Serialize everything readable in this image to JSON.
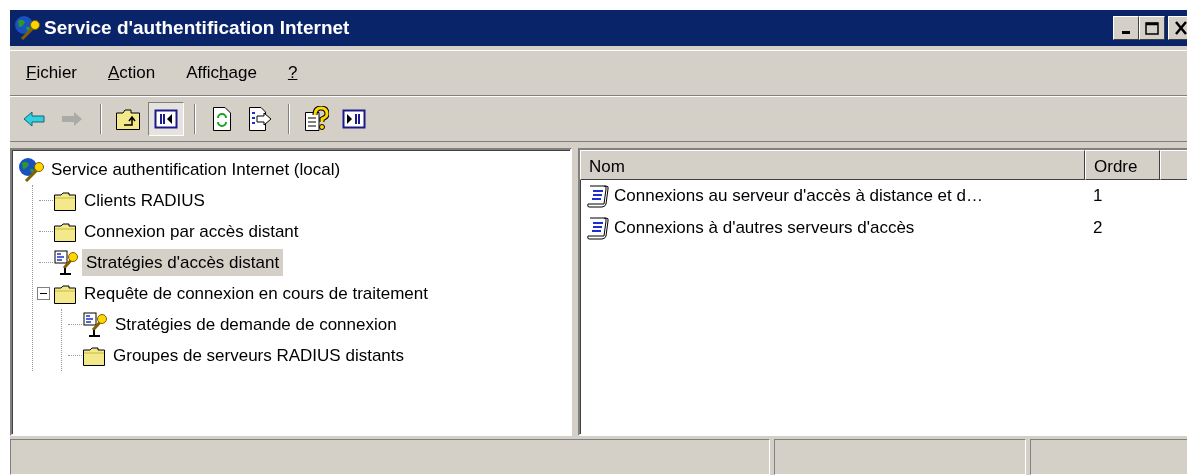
{
  "window": {
    "title": "Service d'authentification Internet"
  },
  "menu": [
    {
      "segments": [
        {
          "text": "F",
          "underlined": true
        },
        {
          "text": "ichier",
          "underlined": false
        }
      ]
    },
    {
      "segments": [
        {
          "text": "A",
          "underlined": true
        },
        {
          "text": "ction",
          "underlined": false
        }
      ]
    },
    {
      "segments": [
        {
          "text": "Affic",
          "underlined": false
        },
        {
          "text": "h",
          "underlined": true
        },
        {
          "text": "age",
          "underlined": false
        }
      ]
    },
    {
      "segments": [
        {
          "text": "?",
          "underlined": true
        }
      ]
    }
  ],
  "toolbar_groups": [
    {
      "buttons": [
        {
          "kind": "back",
          "disabled": false,
          "pressed": false
        },
        {
          "kind": "forward",
          "disabled": true,
          "pressed": false
        }
      ]
    },
    {
      "buttons": [
        {
          "kind": "up",
          "disabled": false,
          "pressed": false
        },
        {
          "kind": "tree-pane",
          "disabled": false,
          "pressed": true
        }
      ]
    },
    {
      "buttons": [
        {
          "kind": "refresh",
          "disabled": false,
          "pressed": false
        },
        {
          "kind": "export",
          "disabled": false,
          "pressed": false
        }
      ]
    },
    {
      "buttons": [
        {
          "kind": "help",
          "disabled": false,
          "pressed": false
        },
        {
          "kind": "action-pane",
          "disabled": false,
          "pressed": false
        }
      ]
    }
  ],
  "tree": [
    {
      "label": "Service authentification Internet (local)",
      "kind": "server",
      "selected": false,
      "children": [
        {
          "label": "Clients RADIUS",
          "kind": "folder",
          "selected": false
        },
        {
          "label": "Connexion par accès distant",
          "kind": "folder",
          "selected": false
        },
        {
          "label": "Stratégies d'accès distant",
          "kind": "policy",
          "selected": true
        },
        {
          "label": "Requête de connexion en cours de traitement",
          "kind": "folder",
          "selected": false,
          "expanded": true,
          "children": [
            {
              "label": "Stratégies de demande de connexion",
              "kind": "policy",
              "selected": false
            },
            {
              "label": "Groupes de serveurs RADIUS distants",
              "kind": "folder",
              "selected": false
            }
          ]
        }
      ]
    }
  ],
  "list": {
    "columns": [
      "Nom",
      "Ordre"
    ],
    "rows": [
      {
        "name": "Connexions au serveur d'accès à distance et d…",
        "order": "1"
      },
      {
        "name": "Connexions à d'autres serveurs d'accès",
        "order": "2"
      }
    ]
  }
}
